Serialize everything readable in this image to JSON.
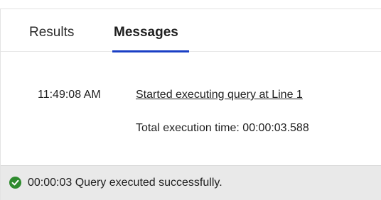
{
  "tabs": {
    "results_label": "Results",
    "messages_label": "Messages",
    "active": "Messages"
  },
  "messages": {
    "time": "11:49:08 AM",
    "started_link": "Started executing query at Line 1",
    "execution_time": "Total execution time: 00:00:03.588"
  },
  "status": {
    "icon": "check-circle-icon",
    "icon_color": "#2e8b2e",
    "text": "00:00:03 Query executed successfully."
  },
  "colors": {
    "accent": "#1a3fc5",
    "status_bar_bg": "#e9e9e9"
  }
}
